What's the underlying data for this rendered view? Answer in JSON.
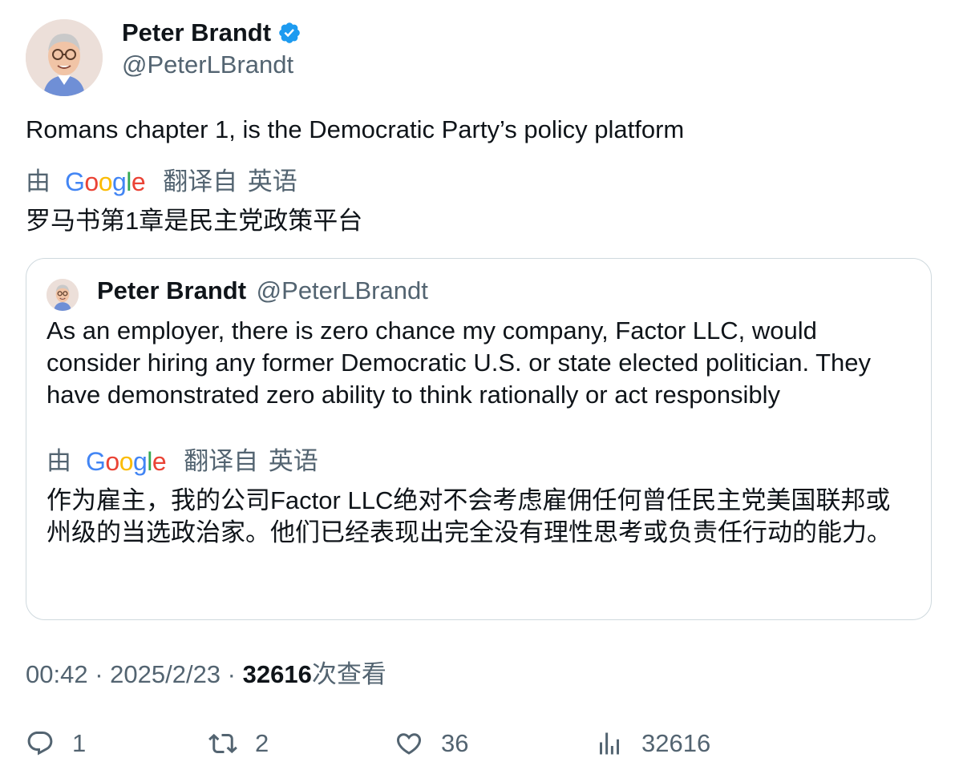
{
  "author": {
    "name": "Peter Brandt",
    "handle": "@PeterLBrandt",
    "verified": true
  },
  "tweet": {
    "text": "Romans chapter 1, is the Democratic Party’s policy platform",
    "translation_by": "由",
    "translation_from": "翻译自 英语",
    "translated_text": "罗马书第1章是民主党政策平台"
  },
  "quoted": {
    "name": "Peter Brandt",
    "handle": "@PeterLBrandt",
    "text": "As an employer, there is zero chance my company, Factor LLC, would consider hiring any former Democratic U.S. or state elected politician. They have demonstrated zero ability to think rationally or act responsibly",
    "translation_by": "由",
    "translation_from": "翻译自 英语",
    "translated_text": "作为雇主，我的公司Factor LLC绝对不会考虑雇佣任何曾任民主党美国联邦或州级的当选政治家。他们已经表现出完全没有理性思考或负责任行动的能力。"
  },
  "meta": {
    "time": "00:42",
    "sep1": " · ",
    "date": "2025/2/23",
    "sep2": " · ",
    "views": "32616",
    "views_label": "次查看"
  },
  "actions": {
    "replies": "1",
    "reposts": "2",
    "likes": "36",
    "views": "32616"
  },
  "colors": {
    "verified": "#1d9bf0",
    "secondary_text": "#536471",
    "border": "#cfd9de"
  }
}
